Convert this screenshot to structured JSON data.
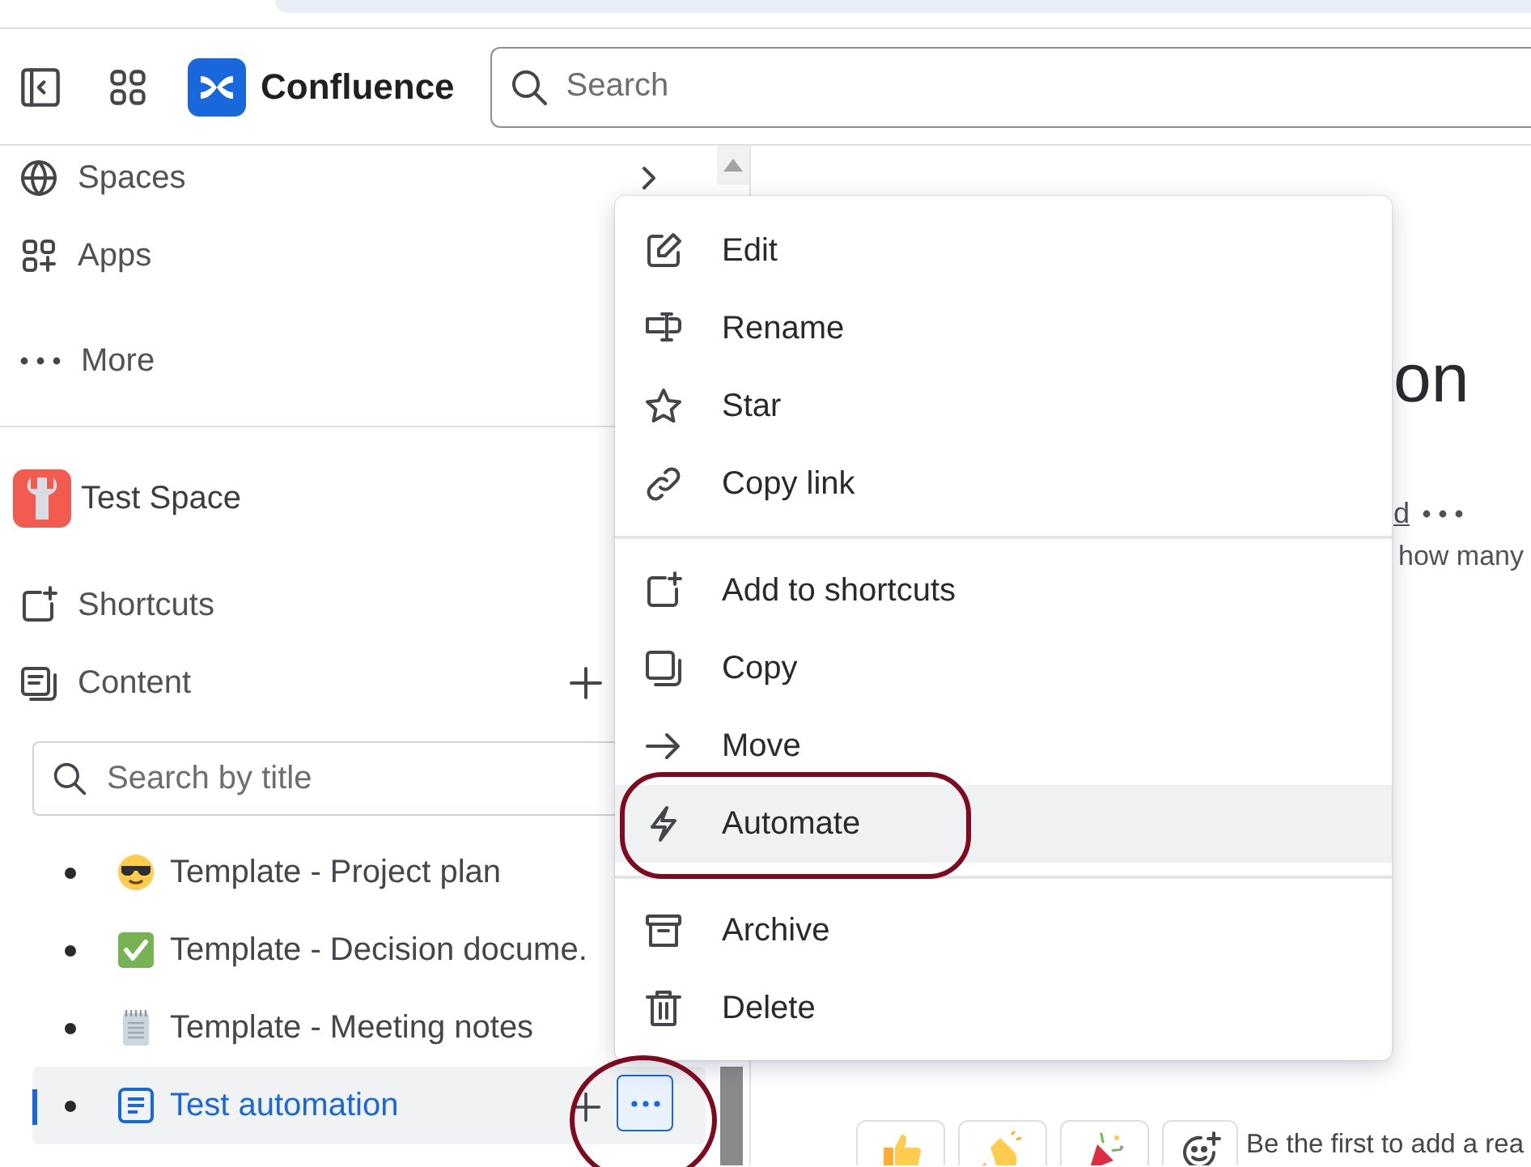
{
  "header": {
    "product": "Confluence",
    "search": {
      "placeholder": "Search"
    }
  },
  "sidebar": {
    "nav": [
      {
        "label": "Spaces"
      },
      {
        "label": "Apps"
      },
      {
        "label": "More"
      }
    ],
    "space": {
      "name": "Test Space"
    },
    "sections": [
      {
        "label": "Shortcuts"
      },
      {
        "label": "Content"
      }
    ],
    "content_search": {
      "placeholder": "Search by title"
    },
    "pages": [
      {
        "title": "Template - Project plan",
        "selected": false
      },
      {
        "title": "Template - Decision docume.",
        "selected": false
      },
      {
        "title": "Template - Meeting notes",
        "selected": false
      },
      {
        "title": "Test automation",
        "selected": true
      }
    ]
  },
  "menu": {
    "groups": [
      [
        {
          "label": "Edit",
          "highlighted": false
        },
        {
          "label": "Rename",
          "highlighted": false
        },
        {
          "label": "Star",
          "highlighted": false
        },
        {
          "label": "Copy link",
          "highlighted": false
        }
      ],
      [
        {
          "label": "Add to shortcuts",
          "highlighted": false
        },
        {
          "label": "Copy",
          "highlighted": false
        },
        {
          "label": "Move",
          "highlighted": false
        },
        {
          "label": "Automate",
          "highlighted": true
        }
      ],
      [
        {
          "label": "Archive",
          "highlighted": false
        },
        {
          "label": "Delete",
          "highlighted": false
        }
      ]
    ]
  },
  "page": {
    "title": "on",
    "byline_link": "d",
    "body": "how many",
    "reaction_prompt": "Be the first to add a rea"
  }
}
